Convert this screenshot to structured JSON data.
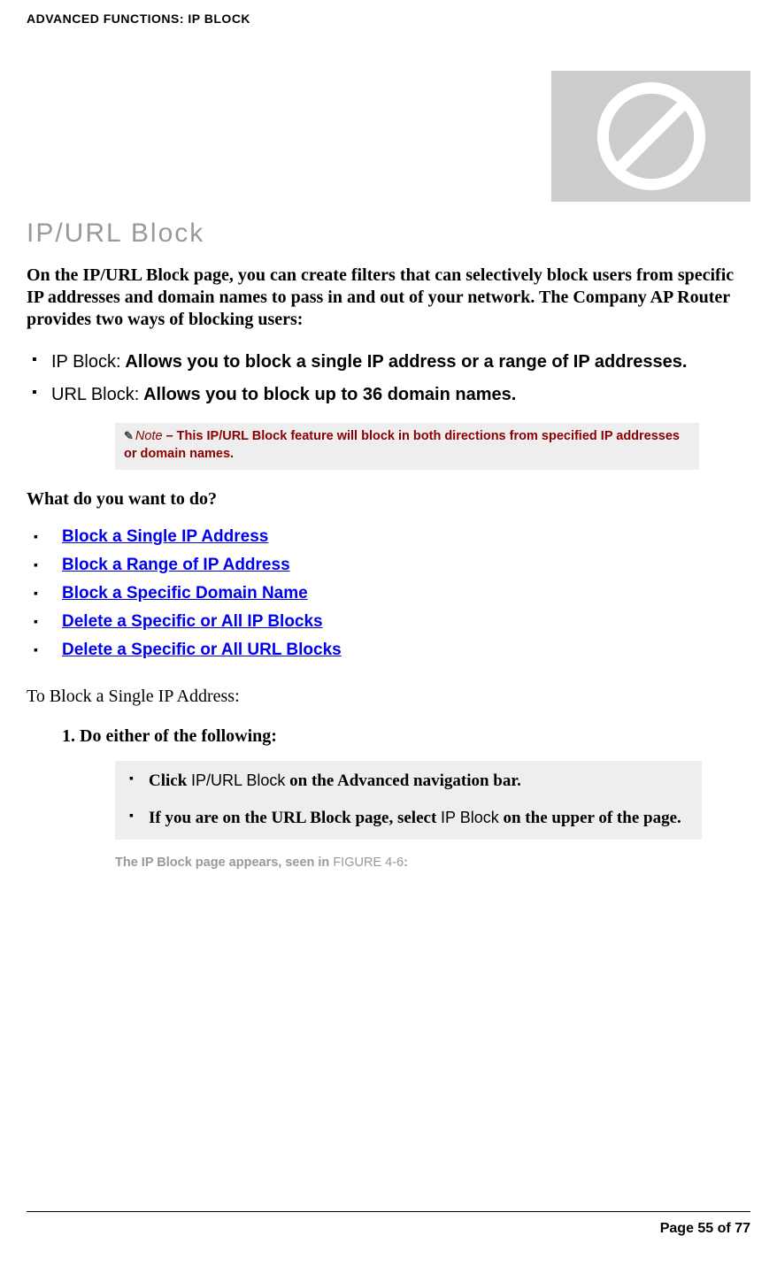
{
  "header": "ADVANCED FUNCTIONS: IP BLOCK",
  "title": "IP/URL Block",
  "intro": "On the IP/URL Block page, you can create filters that can selectively block users from specific IP addresses and domain names to pass in and out of your network. The Company AP Router provides two ways of blocking users:",
  "bullets": [
    {
      "label": "IP Block:",
      "text": " Allows you to block a single IP address or a range of IP addresses."
    },
    {
      "label": "URL Block:",
      "text": " Allows you to block up to 36 domain names."
    }
  ],
  "note": {
    "prefix": "Note",
    "text": " – This IP/URL Block feature will block in both directions from specified IP addresses or domain names."
  },
  "question": "What do you want to do?",
  "links": [
    "Block a Single IP Address",
    "Block a Range of IP Address",
    "Block a Specific Domain Name",
    "Delete a Specific or All IP Blocks",
    "Delete a Specific or All URL Blocks"
  ],
  "sub_heading": "To Block a Single IP Address:",
  "step1": "1.  Do either of the following:",
  "steps": [
    {
      "pre": "Click ",
      "sans": "IP/URL Block",
      "post": " on the Advanced navigation bar."
    },
    {
      "pre": "If you are on the URL Block page, select ",
      "sans": "IP Block",
      "post": " on the upper of the page."
    }
  ],
  "result": {
    "text": "The IP Block page appears, seen in ",
    "fig": "FIGURE 4-6",
    "after": ":"
  },
  "footer": "Page 55 of 77"
}
